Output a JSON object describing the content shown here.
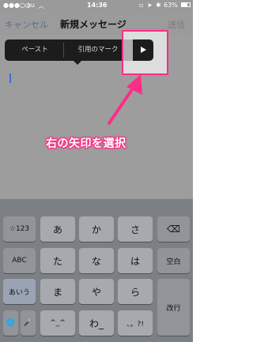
{
  "status": {
    "carrier": "au",
    "wifi_icon": "wifi-icon",
    "time": "14:36",
    "lock_icon": "lock-icon",
    "location_icon": "location-icon",
    "bluetooth_icon": "bluetooth-icon",
    "battery": "63%"
  },
  "nav": {
    "cancel": "キャンセル",
    "title": "新規メッセージ",
    "send": "送信"
  },
  "edit_menu": {
    "items": [
      "ペースト",
      "引用のマーク"
    ],
    "next_icon": "right-triangle-icon"
  },
  "annotation": {
    "text": "右の矢印を選択",
    "arrow_icon": "pink-arrow-icon",
    "highlight_color": "#ff2d86"
  },
  "keyboard": {
    "row1": [
      "☆123",
      "あ",
      "か",
      "さ",
      "⌫"
    ],
    "row2": [
      "ABC",
      "た",
      "な",
      "は",
      "空白"
    ],
    "row3": [
      "あいう",
      "ま",
      "や",
      "ら",
      "改行"
    ],
    "row4": [
      "🌐",
      "🎤",
      "^_^",
      "わ_",
      "、。?!"
    ]
  }
}
